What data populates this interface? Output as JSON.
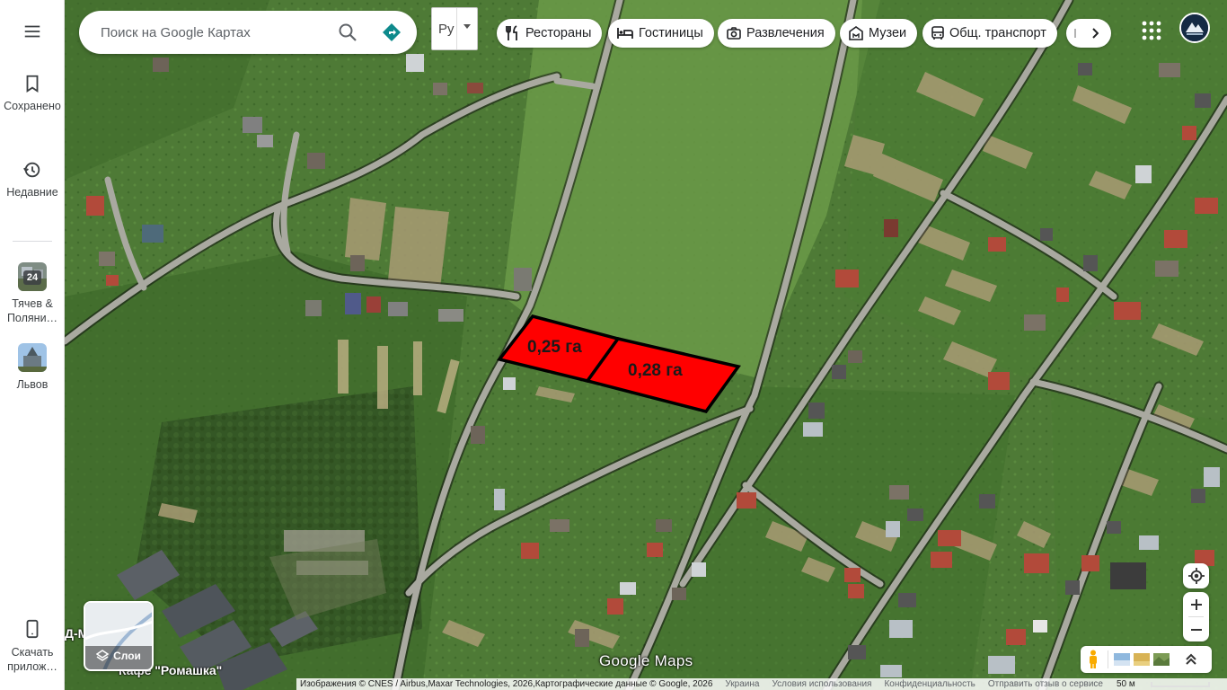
{
  "search": {
    "placeholder": "Поиск на Google Картах"
  },
  "language": {
    "selected": "Ру"
  },
  "chips": [
    {
      "label": "Рестораны",
      "icon": "fork-knife-icon"
    },
    {
      "label": "Гостиницы",
      "icon": "bed-icon"
    },
    {
      "label": "Развлечения",
      "icon": "camera-icon"
    },
    {
      "label": "Музеи",
      "icon": "museum-icon"
    },
    {
      "label": "Общ. транспорт",
      "icon": "bus-icon"
    }
  ],
  "rail": {
    "saved": "Сохранено",
    "recent": "Недавние",
    "place1": "Тячев & Поляни…",
    "place1_badge": "24",
    "place2": "Львов",
    "download": "Скачать прилож…"
  },
  "parcels": [
    {
      "label": "0,25 га",
      "color": "#ff0000"
    },
    {
      "label": "0,28 га",
      "color": "#ff0000"
    }
  ],
  "map_labels": {
    "cafe": "Кафе \"Ромашка\"",
    "cafe_left": "Д-М",
    "brand": "Google Maps"
  },
  "layers": {
    "label": "Слои"
  },
  "footer": {
    "attribution": "Изображения © CNES / Airbus,Maxar Technologies, 2026,Картографические данные © Google, 2026",
    "country": "Украина",
    "terms": "Условия использования",
    "privacy": "Конфиденциальность",
    "feedback": "Отправить отзыв о сервисе",
    "scale": "50 м"
  },
  "colors": {
    "accent": "#1a73e8",
    "directions": "#0e8a8c",
    "parcel_fill": "#ff0000"
  }
}
